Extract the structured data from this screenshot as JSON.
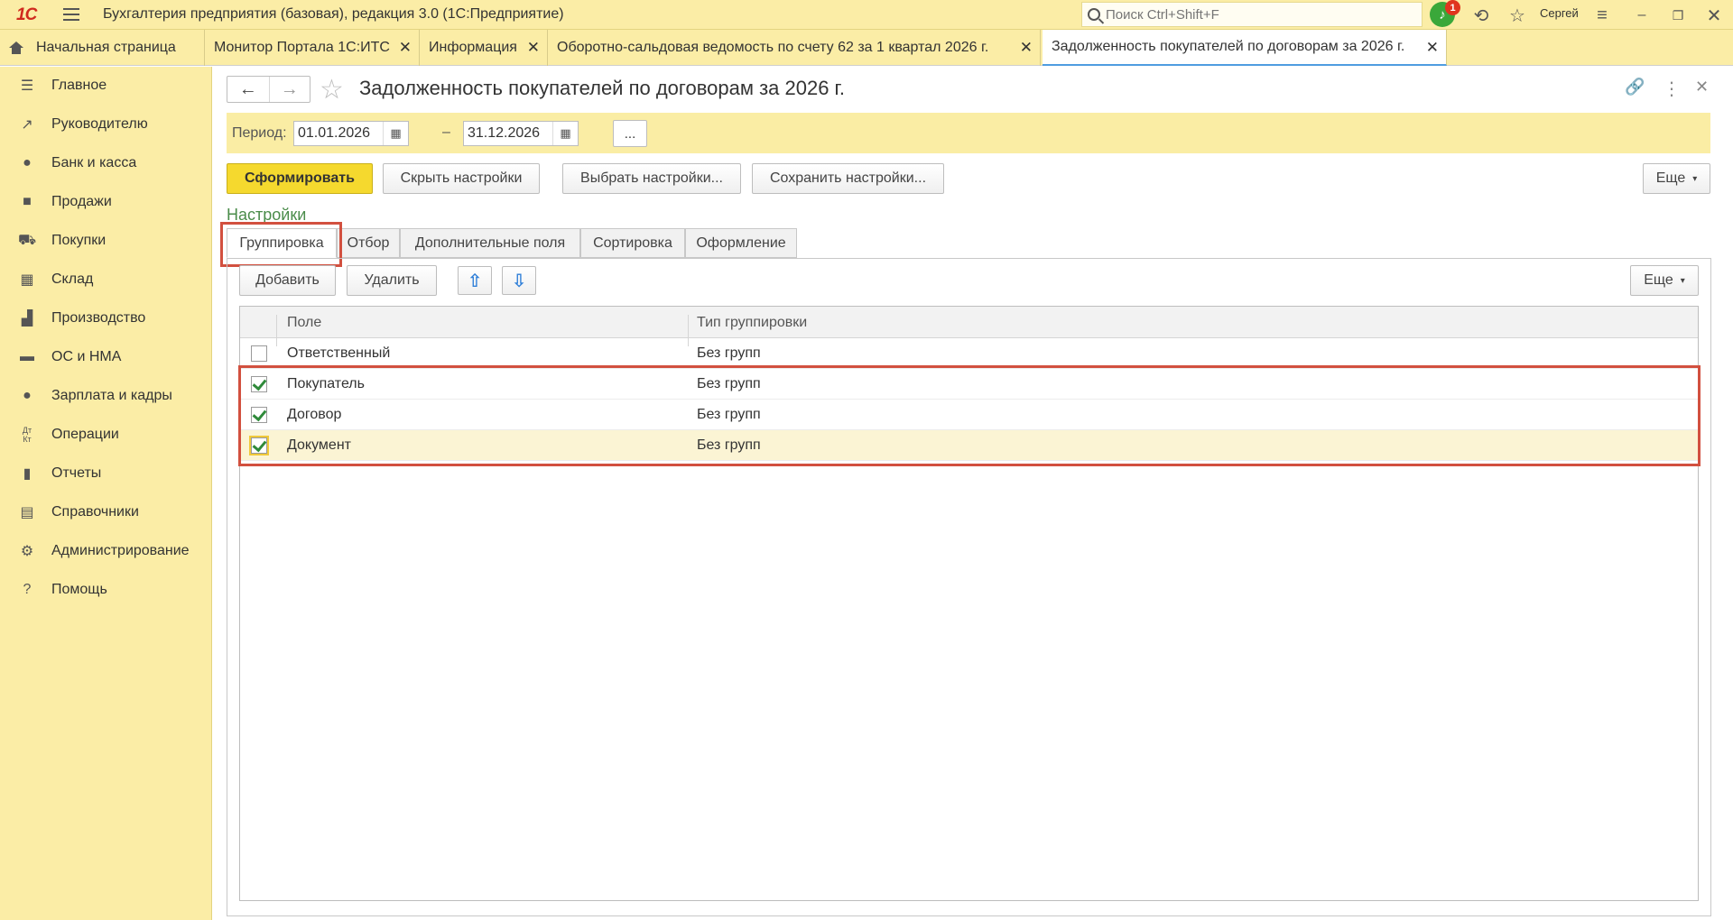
{
  "app": {
    "logo": "1С",
    "title": "Бухгалтерия предприятия (базовая), редакция 3.0  (1С:Предприятие)",
    "search_placeholder": "Поиск Ctrl+Shift+F",
    "notification_count": "1",
    "user": "Сергей"
  },
  "tabs": [
    {
      "label": "Начальная страница"
    },
    {
      "label": "Монитор Портала 1С:ИТС"
    },
    {
      "label": "Информация"
    },
    {
      "label": "Оборотно-сальдовая ведомость по счету 62 за 1 квартал 2026 г."
    },
    {
      "label": "Задолженность покупателей по договорам за 2026 г."
    }
  ],
  "sidebar": {
    "items": [
      {
        "label": "Главное",
        "icon": "menu-lines-icon"
      },
      {
        "label": "Руководителю",
        "icon": "trend-icon"
      },
      {
        "label": "Банк и касса",
        "icon": "ruble-coin-icon"
      },
      {
        "label": "Продажи",
        "icon": "bag-icon"
      },
      {
        "label": "Покупки",
        "icon": "cart-icon"
      },
      {
        "label": "Склад",
        "icon": "warehouse-icon"
      },
      {
        "label": "Производство",
        "icon": "factory-icon"
      },
      {
        "label": "ОС и НМА",
        "icon": "truck-icon"
      },
      {
        "label": "Зарплата и кадры",
        "icon": "person-icon"
      },
      {
        "label": "Операции",
        "icon": "dt-kt-icon"
      },
      {
        "label": "Отчеты",
        "icon": "bar-chart-icon"
      },
      {
        "label": "Справочники",
        "icon": "book-icon"
      },
      {
        "label": "Администрирование",
        "icon": "gear-icon"
      },
      {
        "label": "Помощь",
        "icon": "question-icon"
      }
    ]
  },
  "report": {
    "title": "Задолженность покупателей по договорам за 2026 г.",
    "period_label": "Период:",
    "date_from": "01.01.2026",
    "date_to": "31.12.2026",
    "dash": "–",
    "dots": "...",
    "buttons": {
      "generate": "Сформировать",
      "hide_settings": "Скрыть настройки",
      "choose_settings": "Выбрать настройки...",
      "save_settings": "Сохранить настройки...",
      "more": "Еще"
    },
    "settings_title": "Настройки",
    "settings_tabs": [
      "Группировка",
      "Отбор",
      "Дополнительные поля",
      "Сортировка",
      "Оформление"
    ],
    "grouping": {
      "add": "Добавить",
      "delete": "Удалить",
      "more": "Еще",
      "columns": {
        "field": "Поле",
        "type": "Тип группировки"
      },
      "rows": [
        {
          "checked": false,
          "field": "Ответственный",
          "type": "Без групп"
        },
        {
          "checked": true,
          "field": "Покупатель",
          "type": "Без групп"
        },
        {
          "checked": true,
          "field": "Договор",
          "type": "Без групп"
        },
        {
          "checked": true,
          "field": "Документ",
          "type": "Без групп"
        }
      ]
    }
  },
  "colors": {
    "accent_yellow": "#fbeda6",
    "primary_button": "#f5d92e",
    "highlight_red": "#d2503f",
    "check_green": "#2f8a3a"
  }
}
